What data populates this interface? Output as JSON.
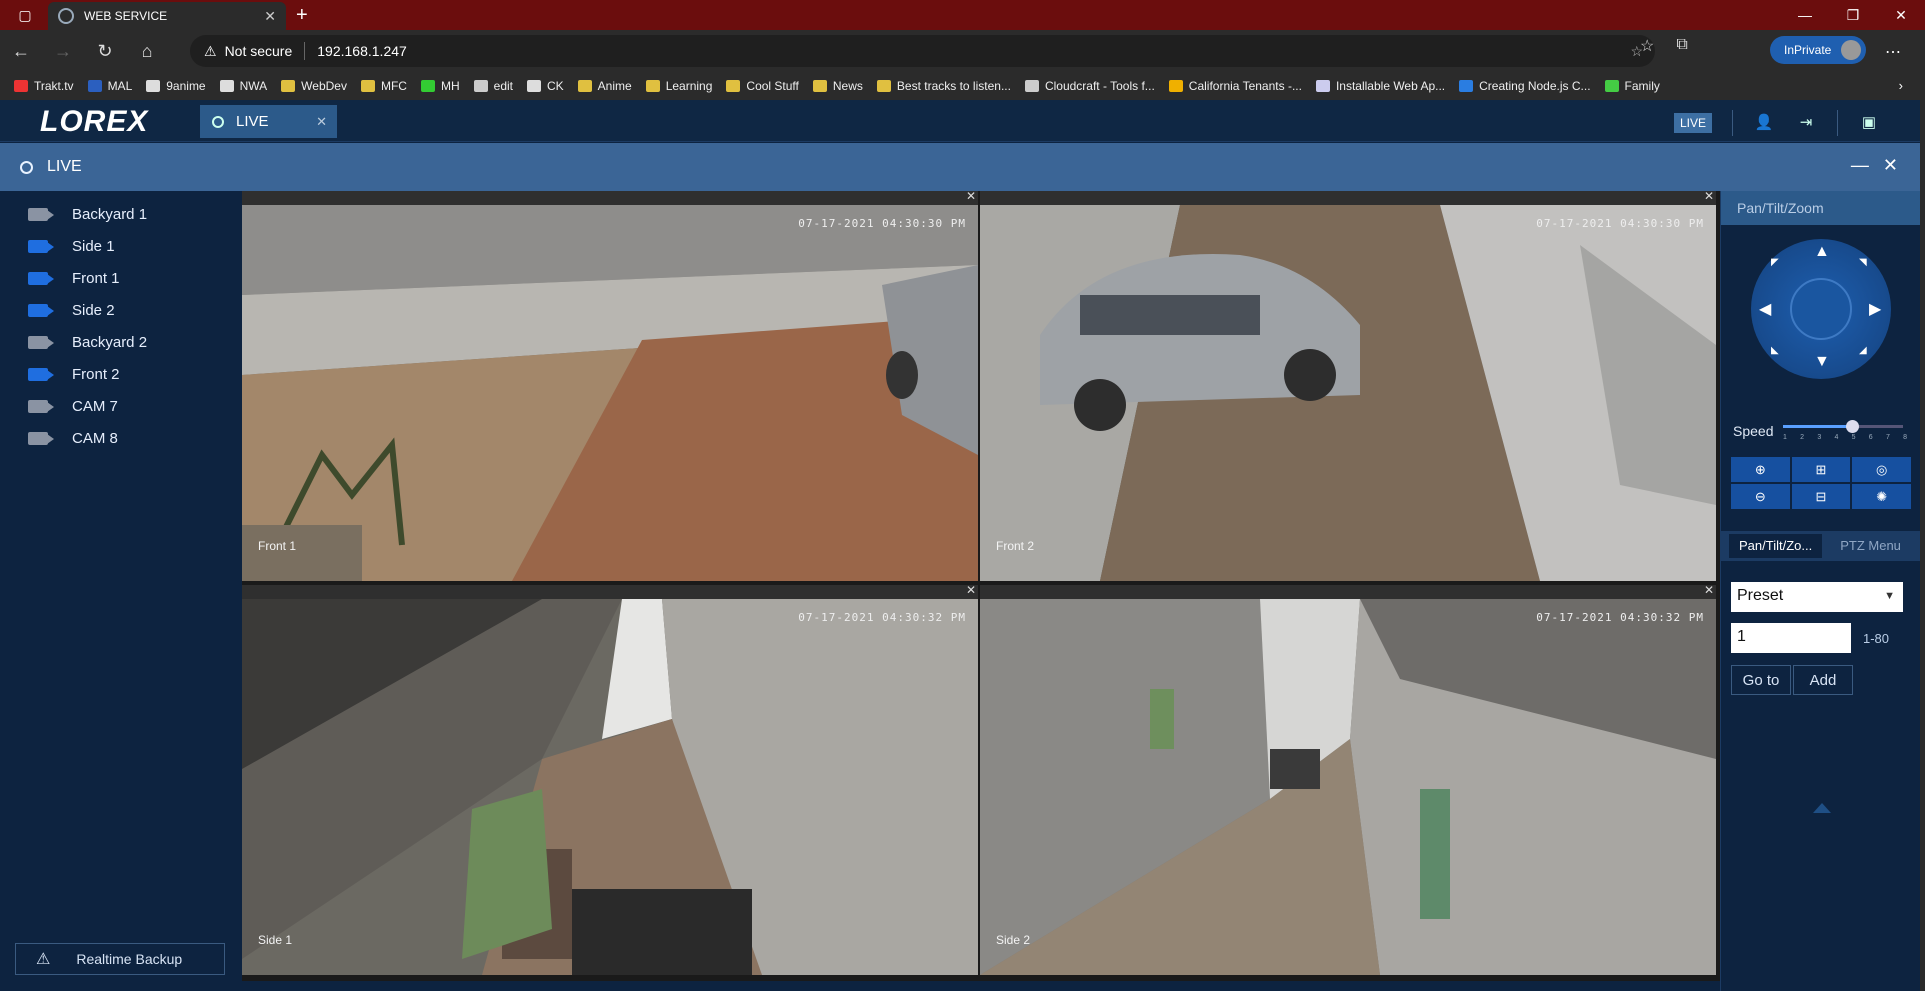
{
  "browser": {
    "tab_title": "WEB SERVICE",
    "security_label": "Not secure",
    "url": "192.168.1.247",
    "profile_label": "InPrivate",
    "bookmarks": [
      "Trakt.tv",
      "MAL",
      "9anime",
      "NWA",
      "WebDev",
      "MFC",
      "MH",
      "edit",
      "CK",
      "Anime",
      "Learning",
      "Cool Stuff",
      "News",
      "Best tracks to listen...",
      "Cloudcraft - Tools f...",
      "California Tenants -...",
      "Installable Web Ap...",
      "Creating Node.js C...",
      "Family"
    ]
  },
  "app": {
    "logo": "LOREX",
    "tab_label": "LIVE",
    "live_badge": "LIVE",
    "section_title": "LIVE"
  },
  "sidebar": {
    "cameras": [
      {
        "label": "Backyard 1",
        "active": false
      },
      {
        "label": "Side 1",
        "active": true
      },
      {
        "label": "Front 1",
        "active": true
      },
      {
        "label": "Side 2",
        "active": true
      },
      {
        "label": "Backyard 2",
        "active": false
      },
      {
        "label": "Front 2",
        "active": true
      },
      {
        "label": "CAM 7",
        "active": false
      },
      {
        "label": "CAM 8",
        "active": false
      }
    ],
    "backup_label": "Realtime Backup"
  },
  "views": [
    {
      "label": "Front 1",
      "timestamp": "07-17-2021 04:30:30 PM",
      "selected": false
    },
    {
      "label": "Front 2",
      "timestamp": "07-17-2021 04:30:30 PM",
      "selected": false
    },
    {
      "label": "Side 1",
      "timestamp": "07-17-2021 04:30:32 PM",
      "selected": true
    },
    {
      "label": "Side 2",
      "timestamp": "07-17-2021 04:30:32 PM",
      "selected": false
    }
  ],
  "ptz": {
    "title": "Pan/Tilt/Zoom",
    "speed_label": "Speed",
    "speed_value": 5,
    "speed_max": 8,
    "speed_ticks": [
      "1",
      "2",
      "3",
      "4",
      "5",
      "6",
      "7",
      "8"
    ],
    "tabs": [
      "Pan/Tilt/Zo...",
      "PTZ Menu"
    ],
    "preset_label": "Preset",
    "preset_number": "1",
    "preset_range": "1-80",
    "goto_label": "Go to",
    "add_label": "Add"
  },
  "colors": {
    "accent": "#1f6ee0",
    "header": "#3b6596",
    "selected_border": "#3ad13a"
  }
}
